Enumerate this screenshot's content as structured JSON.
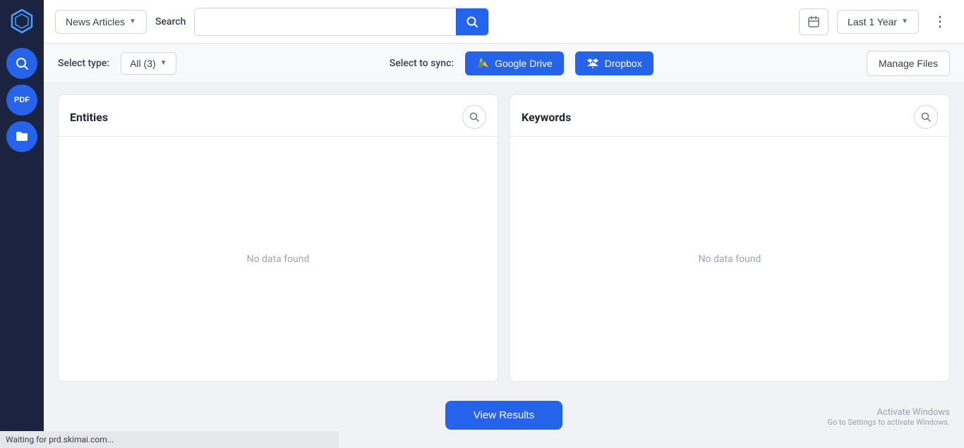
{
  "sidebar": {
    "logo_icon": "⬡",
    "items": [
      {
        "id": "search",
        "icon": "🔍",
        "label": "Search"
      },
      {
        "id": "pdf",
        "icon": "PDF",
        "label": "PDF"
      },
      {
        "id": "folder",
        "icon": "📁",
        "label": "Folder"
      }
    ]
  },
  "header": {
    "news_articles_label": "News Articles",
    "search_label": "Search",
    "search_placeholder": "",
    "calendar_icon": "📅",
    "last_year_label": "Last 1 Year",
    "more_icon": "⋮"
  },
  "filter_bar": {
    "select_type_label": "Select type:",
    "type_value": "All (3)",
    "select_sync_label": "Select to sync:",
    "google_drive_label": "Google Drive",
    "dropbox_label": "Dropbox",
    "manage_files_label": "Manage Files"
  },
  "panels": [
    {
      "id": "entities",
      "title": "Entities",
      "no_data_text": "No data found"
    },
    {
      "id": "keywords",
      "title": "Keywords",
      "no_data_text": "No data found"
    }
  ],
  "bottom": {
    "view_results_label": "View Results"
  },
  "status_bar": {
    "text": "Waiting for prd.skimai.com..."
  },
  "watermark": {
    "line1": "Activate Windows",
    "line2": "Go to Settings to activate Windows."
  }
}
